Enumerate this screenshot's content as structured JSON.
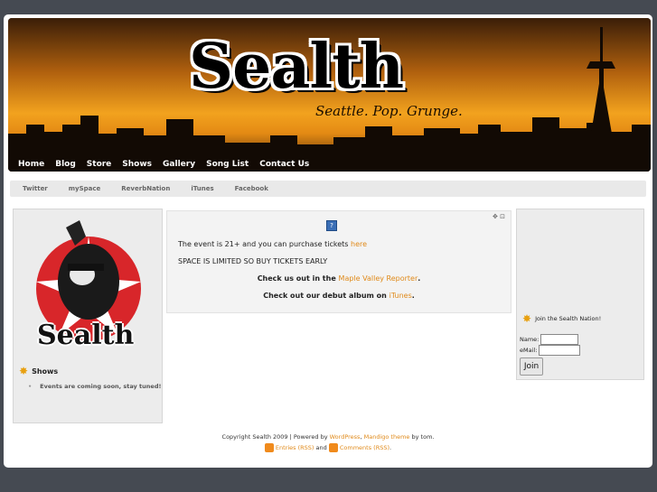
{
  "header": {
    "logo": "Sealth",
    "tagline": "Seattle. Pop. Grunge."
  },
  "main_nav": [
    "Home",
    "Blog",
    "Store",
    "Shows",
    "Gallery",
    "Song List",
    "Contact Us"
  ],
  "sub_nav": [
    "Twitter",
    "mySpace",
    "ReverbNation",
    "iTunes",
    "Facebook"
  ],
  "sidebar_left": {
    "image_text": "Sealth",
    "shows_title": "Shows",
    "shows_item": "Events are coming soon, stay tuned!"
  },
  "content": {
    "line1_text": "The event is 21+ and you can purchase tickets",
    "line1_link": "here",
    "line2": "SPACE IS LIMITED SO BUY TICKETS EARLY",
    "line3_text": "Check us out in the",
    "line3_link": "Maple Valley Reporter",
    "line3_end": ".",
    "line4_text": "Check out our debut album on",
    "line4_link": "iTunes",
    "line4_end": "."
  },
  "sidebar_right": {
    "title": "Join the Sealth Nation!",
    "name_label": "Name:",
    "email_label": "eMail:",
    "join_button": "Join"
  },
  "footer": {
    "copyright_prefix": "Copyright Sealth 2009 | Powered by",
    "wordpress": "WordPress",
    "separator": ",",
    "theme": "Mandigo theme",
    "by": "by tom.",
    "entries": "Entries (RSS)",
    "and": "and",
    "comments": "Comments (RSS)",
    "period": "."
  },
  "colors": {
    "accent": "#e08a1a",
    "sunset": "#f29a1c"
  }
}
